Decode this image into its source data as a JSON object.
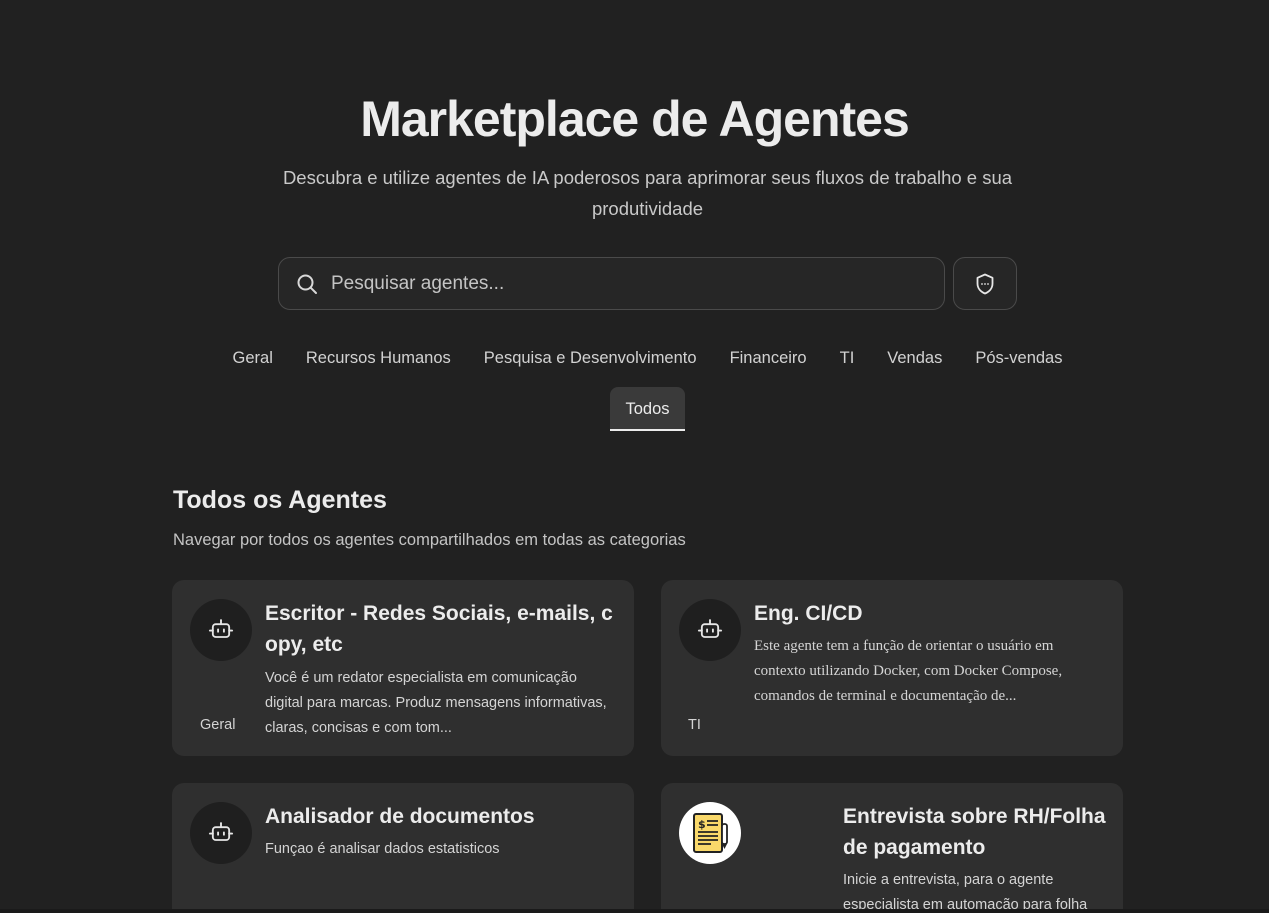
{
  "hero": {
    "title": "Marketplace de Agentes",
    "subtitle": "Descubra e utilize agentes de IA poderosos para aprimorar seus fluxos de trabalho e sua produtividade"
  },
  "search": {
    "placeholder": "Pesquisar agentes...",
    "value": ""
  },
  "tabs": [
    {
      "label": "Geral"
    },
    {
      "label": "Recursos Humanos"
    },
    {
      "label": "Pesquisa e Desenvolvimento"
    },
    {
      "label": "Financeiro"
    },
    {
      "label": "TI"
    },
    {
      "label": "Vendas"
    },
    {
      "label": "Pós-vendas"
    }
  ],
  "active_tab": {
    "label": "Todos"
  },
  "section": {
    "title": "Todos os Agentes",
    "subtitle": "Navegar por todos os agentes compartilhados em todas as categorias"
  },
  "agents": [
    {
      "name": "Escritor - Redes Sociais, e-mails, copy, etc",
      "description": "Você é um redator especialista em comunicação digital para marcas. Produz mensagens informativas, claras, concisas e com tom...",
      "category": "Geral",
      "icon": "bot-icon"
    },
    {
      "name": "Eng. CI/CD",
      "description": "Este agente tem a função de orientar o usuário em contexto utilizando Docker, com Docker Compose, comandos de terminal e documentação de...",
      "category": "TI",
      "icon": "bot-icon"
    },
    {
      "name": "Analisador de documentos",
      "description": "Funçao é analisar dados estatisticos",
      "category": "",
      "icon": "bot-icon"
    },
    {
      "name": "Entrevista sobre RH/Folha de pagamento",
      "description": "Inicie a entrevista, para o agente especialista em automação para folha",
      "category": "",
      "icon": "payroll-document-icon"
    }
  ],
  "colors": {
    "background": "#212121",
    "card": "#2f2f2f",
    "text": "#ececec",
    "muted": "#c4c4c4",
    "payroll_yellow": "#f9d86a"
  }
}
